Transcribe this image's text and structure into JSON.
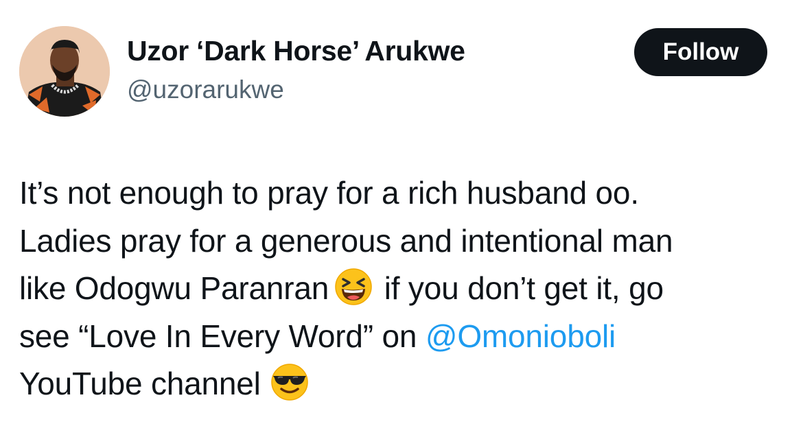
{
  "author": {
    "display_name": "Uzor ‘Dark Horse’ Arukwe",
    "handle": "@uzorarukwe"
  },
  "follow_button": {
    "label": "Follow"
  },
  "tweet": {
    "line1": "It’s not enough to pray for a rich husband oo.",
    "line2": "Ladies pray for a generous and intentional man",
    "line3_before": "like Odogwu Paranran",
    "line3_emoji": "laughing-squinting-face-emoji",
    "line3_after": "if you don’t get it, go",
    "line4_before": "see “Love In Every Word” on ",
    "line4_mention": "@Omonioboli",
    "line5_before": "YouTube channel",
    "line5_emoji": "smiling-face-with-sunglasses-emoji"
  },
  "colors": {
    "mention": "#1d9bf0",
    "handle": "#536471",
    "text": "#0f1419",
    "follow_bg": "#0f1419"
  }
}
